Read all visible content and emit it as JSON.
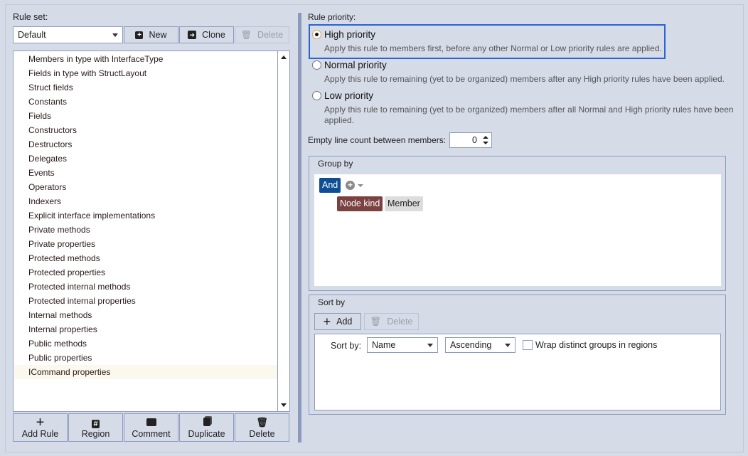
{
  "rule_set": {
    "label": "Rule set:",
    "selected": "Default",
    "new_label": "New",
    "clone_label": "Clone",
    "delete_label": "Delete"
  },
  "rules": [
    "Members in type with InterfaceType",
    "Fields in type with StructLayout",
    "Struct fields",
    "Constants",
    "Fields",
    "Constructors",
    "Destructors",
    "Delegates",
    "Events",
    "Operators",
    "Indexers",
    "Explicit interface implementations",
    "Private methods",
    "Private properties",
    "Protected methods",
    "Protected properties",
    "Protected internal methods",
    "Protected internal properties",
    "Internal methods",
    "Internal properties",
    "Public methods",
    "Public properties",
    "ICommand properties"
  ],
  "selected_rule": "ICommand properties",
  "bottom_buttons": {
    "add_rule": "Add Rule",
    "region": "Region",
    "comment": "Comment",
    "duplicate": "Duplicate",
    "delete": "Delete"
  },
  "priority": {
    "label": "Rule priority:",
    "selected": "high",
    "high": {
      "title": "High priority",
      "desc": "Apply this rule to members first, before any other Normal or Low priority rules are applied."
    },
    "normal": {
      "title": "Normal priority",
      "desc": "Apply this rule to remaining (yet to be organized) members after any High priority rules have been applied."
    },
    "low": {
      "title": "Low priority",
      "desc": "Apply this rule to remaining (yet to be organized) members after all Normal and High priority rules have been applied."
    }
  },
  "empty_lines": {
    "label": "Empty line count between members:",
    "value": "0"
  },
  "group_by": {
    "title": "Group by",
    "operator": "And",
    "criterion": "Node kind",
    "value": "Member"
  },
  "sort_by": {
    "title": "Sort by",
    "add_label": "Add",
    "delete_label": "Delete",
    "row_label": "Sort by:",
    "field": "Name",
    "direction": "Ascending",
    "wrap_label": "Wrap distinct groups in regions",
    "wrap_checked": false
  },
  "colors": {
    "and_tag": "#0e4f94",
    "node_kind_tag": "#7b4040",
    "member_tag": "#dcdcdc",
    "focus_border": "#2a63d2",
    "splitter": "#8d98bd"
  }
}
